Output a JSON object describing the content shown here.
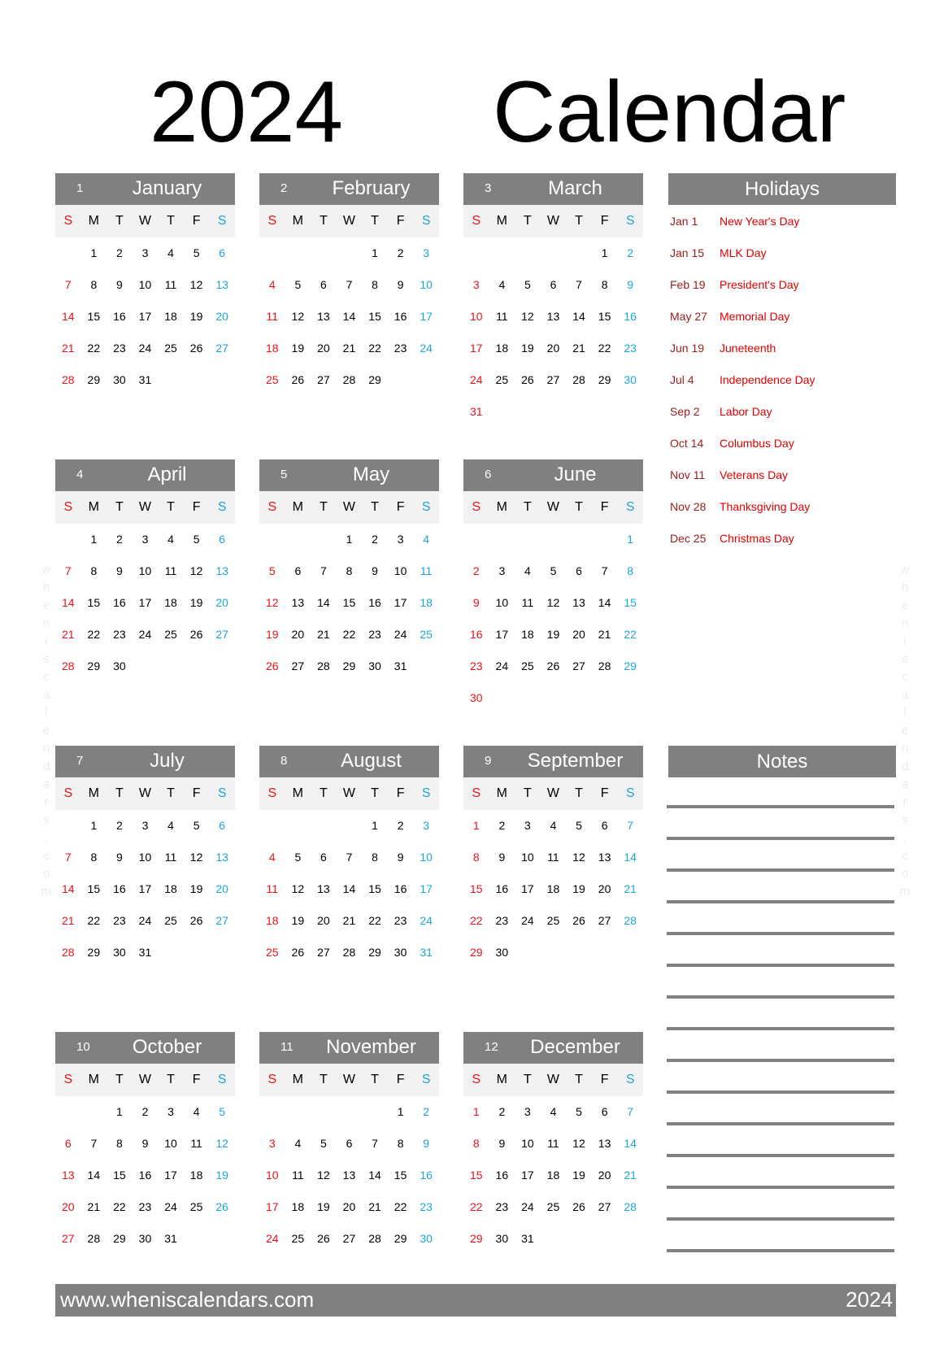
{
  "title": {
    "year": "2024",
    "word": "Calendar"
  },
  "weekday_labels": [
    "S",
    "M",
    "T",
    "W",
    "T",
    "F",
    "S"
  ],
  "colors": {
    "header_bg": "#808080",
    "weekday_strip_bg": "#f2f2f2",
    "sunday": "#e8121b",
    "saturday": "#1aa6dd",
    "holiday_date": "#9b1c1c",
    "holiday_name": "#e00000"
  },
  "months": [
    {
      "num": "1",
      "name": "January",
      "weeks": [
        [
          "",
          "1",
          "2",
          "3",
          "4",
          "5",
          "6"
        ],
        [
          "7",
          "8",
          "9",
          "10",
          "11",
          "12",
          "13"
        ],
        [
          "14",
          "15",
          "16",
          "17",
          "18",
          "19",
          "20"
        ],
        [
          "21",
          "22",
          "23",
          "24",
          "25",
          "26",
          "27"
        ],
        [
          "28",
          "29",
          "30",
          "31",
          "",
          "",
          ""
        ]
      ]
    },
    {
      "num": "2",
      "name": "February",
      "weeks": [
        [
          "",
          "",
          "",
          "",
          "1",
          "2",
          "3"
        ],
        [
          "4",
          "5",
          "6",
          "7",
          "8",
          "9",
          "10"
        ],
        [
          "11",
          "12",
          "13",
          "14",
          "15",
          "16",
          "17"
        ],
        [
          "18",
          "19",
          "20",
          "21",
          "22",
          "23",
          "24"
        ],
        [
          "25",
          "26",
          "27",
          "28",
          "29",
          "",
          ""
        ]
      ]
    },
    {
      "num": "3",
      "name": "March",
      "weeks": [
        [
          "",
          "",
          "",
          "",
          "",
          "1",
          "2"
        ],
        [
          "3",
          "4",
          "5",
          "6",
          "7",
          "8",
          "9"
        ],
        [
          "10",
          "11",
          "12",
          "13",
          "14",
          "15",
          "16"
        ],
        [
          "17",
          "18",
          "19",
          "20",
          "21",
          "22",
          "23"
        ],
        [
          "24",
          "25",
          "26",
          "27",
          "28",
          "29",
          "30"
        ],
        [
          "31",
          "",
          "",
          "",
          "",
          "",
          ""
        ]
      ]
    },
    {
      "num": "4",
      "name": "April",
      "weeks": [
        [
          "",
          "1",
          "2",
          "3",
          "4",
          "5",
          "6"
        ],
        [
          "7",
          "8",
          "9",
          "10",
          "11",
          "12",
          "13"
        ],
        [
          "14",
          "15",
          "16",
          "17",
          "18",
          "19",
          "20"
        ],
        [
          "21",
          "22",
          "23",
          "24",
          "25",
          "26",
          "27"
        ],
        [
          "28",
          "29",
          "30",
          "",
          "",
          "",
          ""
        ]
      ]
    },
    {
      "num": "5",
      "name": "May",
      "weeks": [
        [
          "",
          "",
          "",
          "1",
          "2",
          "3",
          "4"
        ],
        [
          "5",
          "6",
          "7",
          "8",
          "9",
          "10",
          "11"
        ],
        [
          "12",
          "13",
          "14",
          "15",
          "16",
          "17",
          "18"
        ],
        [
          "19",
          "20",
          "21",
          "22",
          "23",
          "24",
          "25"
        ],
        [
          "26",
          "27",
          "28",
          "29",
          "30",
          "31",
          ""
        ]
      ]
    },
    {
      "num": "6",
      "name": "June",
      "weeks": [
        [
          "",
          "",
          "",
          "",
          "",
          "",
          "1"
        ],
        [
          "2",
          "3",
          "4",
          "5",
          "6",
          "7",
          "8"
        ],
        [
          "9",
          "10",
          "11",
          "12",
          "13",
          "14",
          "15"
        ],
        [
          "16",
          "17",
          "18",
          "19",
          "20",
          "21",
          "22"
        ],
        [
          "23",
          "24",
          "25",
          "26",
          "27",
          "28",
          "29"
        ],
        [
          "30",
          "",
          "",
          "",
          "",
          "",
          ""
        ]
      ]
    },
    {
      "num": "7",
      "name": "July",
      "weeks": [
        [
          "",
          "1",
          "2",
          "3",
          "4",
          "5",
          "6"
        ],
        [
          "7",
          "8",
          "9",
          "10",
          "11",
          "12",
          "13"
        ],
        [
          "14",
          "15",
          "16",
          "17",
          "18",
          "19",
          "20"
        ],
        [
          "21",
          "22",
          "23",
          "24",
          "25",
          "26",
          "27"
        ],
        [
          "28",
          "29",
          "30",
          "31",
          "",
          "",
          ""
        ]
      ]
    },
    {
      "num": "8",
      "name": "August",
      "weeks": [
        [
          "",
          "",
          "",
          "",
          "1",
          "2",
          "3"
        ],
        [
          "4",
          "5",
          "6",
          "7",
          "8",
          "9",
          "10"
        ],
        [
          "11",
          "12",
          "13",
          "14",
          "15",
          "16",
          "17"
        ],
        [
          "18",
          "19",
          "20",
          "21",
          "22",
          "23",
          "24"
        ],
        [
          "25",
          "26",
          "27",
          "28",
          "29",
          "30",
          "31"
        ]
      ]
    },
    {
      "num": "9",
      "name": "September",
      "weeks": [
        [
          "1",
          "2",
          "3",
          "4",
          "5",
          "6",
          "7"
        ],
        [
          "8",
          "9",
          "10",
          "11",
          "12",
          "13",
          "14"
        ],
        [
          "15",
          "16",
          "17",
          "18",
          "19",
          "20",
          "21"
        ],
        [
          "22",
          "23",
          "24",
          "25",
          "26",
          "27",
          "28"
        ],
        [
          "29",
          "30",
          "",
          "",
          "",
          "",
          ""
        ]
      ]
    },
    {
      "num": "10",
      "name": "October",
      "weeks": [
        [
          "",
          "",
          "1",
          "2",
          "3",
          "4",
          "5"
        ],
        [
          "6",
          "7",
          "8",
          "9",
          "10",
          "11",
          "12"
        ],
        [
          "13",
          "14",
          "15",
          "16",
          "17",
          "18",
          "19"
        ],
        [
          "20",
          "21",
          "22",
          "23",
          "24",
          "25",
          "26"
        ],
        [
          "27",
          "28",
          "29",
          "30",
          "31",
          "",
          ""
        ]
      ]
    },
    {
      "num": "11",
      "name": "November",
      "weeks": [
        [
          "",
          "",
          "",
          "",
          "",
          "1",
          "2"
        ],
        [
          "3",
          "4",
          "5",
          "6",
          "7",
          "8",
          "9"
        ],
        [
          "10",
          "11",
          "12",
          "13",
          "14",
          "15",
          "16"
        ],
        [
          "17",
          "18",
          "19",
          "20",
          "21",
          "22",
          "23"
        ],
        [
          "24",
          "25",
          "26",
          "27",
          "28",
          "29",
          "30"
        ]
      ]
    },
    {
      "num": "12",
      "name": "December",
      "weeks": [
        [
          "1",
          "2",
          "3",
          "4",
          "5",
          "6",
          "7"
        ],
        [
          "8",
          "9",
          "10",
          "11",
          "12",
          "13",
          "14"
        ],
        [
          "15",
          "16",
          "17",
          "18",
          "19",
          "20",
          "21"
        ],
        [
          "22",
          "23",
          "24",
          "25",
          "26",
          "27",
          "28"
        ],
        [
          "29",
          "30",
          "31",
          "",
          "",
          "",
          ""
        ]
      ]
    }
  ],
  "holidays": {
    "title": "Holidays",
    "items": [
      {
        "date": "Jan 1",
        "name": "New Year's Day"
      },
      {
        "date": "Jan 15",
        "name": "MLK Day"
      },
      {
        "date": "Feb 19",
        "name": "President's Day"
      },
      {
        "date": "May 27",
        "name": "Memorial Day"
      },
      {
        "date": "Jun 19",
        "name": "Juneteenth"
      },
      {
        "date": "Jul 4",
        "name": "Independence Day"
      },
      {
        "date": "Sep 2",
        "name": "Labor Day"
      },
      {
        "date": "Oct 14",
        "name": "Columbus Day"
      },
      {
        "date": "Nov 11",
        "name": "Veterans Day"
      },
      {
        "date": "Nov 28",
        "name": "Thanksgiving Day"
      },
      {
        "date": "Dec 25",
        "name": "Christmas Day"
      }
    ]
  },
  "notes": {
    "title": "Notes",
    "line_count": 15
  },
  "watermark": "wheniscalendars.com",
  "footer": {
    "url": "www.wheniscalendars.com",
    "year": "2024"
  }
}
